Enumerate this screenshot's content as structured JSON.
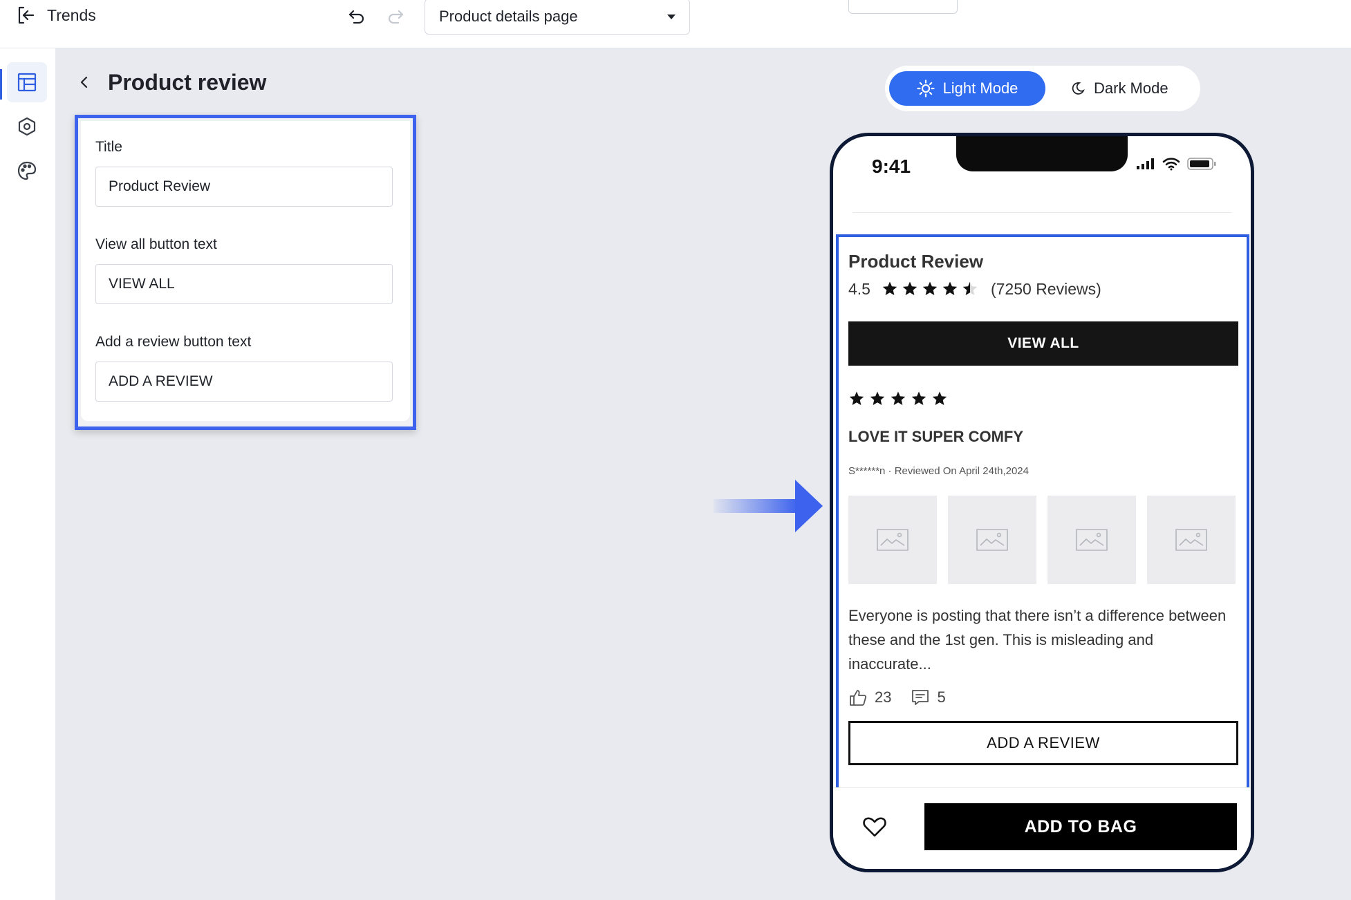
{
  "header": {
    "app_title": "Trends",
    "page_selector_value": "Product details page"
  },
  "editor": {
    "panel_title": "Product review",
    "fields": [
      {
        "label": "Title",
        "value": "Product Review"
      },
      {
        "label": "View all button text",
        "value": "VIEW ALL"
      },
      {
        "label": "Add a review button text",
        "value": "ADD A REVIEW"
      }
    ]
  },
  "preview": {
    "mode_toggle": {
      "light_label": "Light Mode",
      "dark_label": "Dark Mode",
      "active": "light"
    },
    "status_time": "9:41",
    "review_section": {
      "title": "Product Review",
      "rating": "4.5",
      "rating_value": 4.5,
      "review_count": "(7250 Reviews)",
      "view_all_label": "VIEW ALL",
      "review": {
        "stars": 5,
        "heading": "LOVE IT SUPER COMFY",
        "meta": "S******n · Reviewed On April 24th,2024",
        "image_count": 4,
        "body": "Everyone is posting that there isn’t a difference between these and the 1st gen. This is misleading and inaccurate...",
        "likes": "23",
        "comments": "5"
      },
      "add_review_label": "ADD A REVIEW"
    },
    "add_to_bag_label": "ADD TO BAG"
  },
  "colors": {
    "accent_blue": "#2f6cf0",
    "selection_border": "#3d63ee",
    "canvas_bg": "#e8eaef"
  },
  "icons": {
    "exit": "exit-icon",
    "undo": "undo-icon",
    "redo": "redo-icon",
    "rail": [
      "layout-icon",
      "settings-hexagon-icon",
      "palette-icon"
    ],
    "back": "chevron-left-icon",
    "light_mode": "sun-icon",
    "dark_mode": "moon-icon",
    "like": "thumbs-up-icon",
    "comment": "comment-icon",
    "favorite": "heart-icon"
  }
}
